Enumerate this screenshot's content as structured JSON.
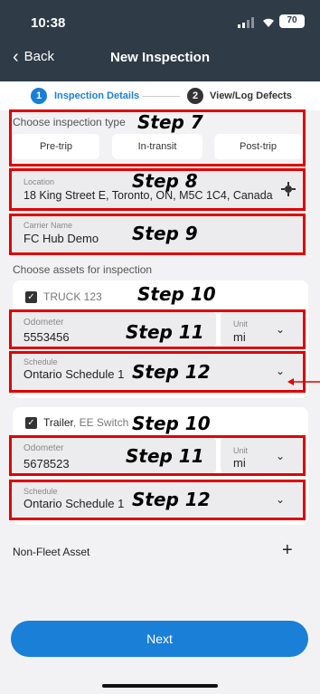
{
  "status": {
    "time": "10:38",
    "battery": "70"
  },
  "nav": {
    "back_label": "Back",
    "title": "New Inspection"
  },
  "stepper": {
    "step1_num": "1",
    "step1_label": "Inspection Details",
    "step2_num": "2",
    "step2_label": "View/Log Defects"
  },
  "inspection_type": {
    "label": "Choose inspection type",
    "options": [
      "Pre-trip",
      "In-transit",
      "Post-trip"
    ]
  },
  "location": {
    "label": "Location",
    "value": "18 King Street E, Toronto, ON, M5C 1C4, Canada"
  },
  "carrier": {
    "label": "Carrier Name",
    "value": "FC Hub Demo"
  },
  "assets": {
    "label": "Choose assets for inspection",
    "truck": {
      "name": "TRUCK 123",
      "odometer_label": "Odometer",
      "odometer_value": "5553456",
      "unit_label": "Unit",
      "unit_value": "mi",
      "schedule_label": "Schedule",
      "schedule_value": "Ontario Schedule 1"
    },
    "trailer": {
      "name_bold": "Trailer",
      "name_rest": ", EE Switch",
      "odometer_label": "Odometer",
      "odometer_value": "5678523",
      "unit_label": "Unit",
      "unit_value": "mi",
      "schedule_label": "Schedule",
      "schedule_value": "Ontario Schedule 1"
    }
  },
  "non_fleet": {
    "label": "Non-Fleet Asset",
    "add": "+"
  },
  "next_label": "Next",
  "annotations": {
    "step7": "Step 7",
    "step8": "Step 8",
    "step9": "Step 9",
    "step10a": "Step 10",
    "step11a": "Step 11",
    "step12a": "Step 12",
    "step10b": "Step 10",
    "step11b": "Step 11",
    "step12b": "Step 12"
  },
  "colors": {
    "accent": "#1a7fd6",
    "header": "#2f3b47",
    "annotation": "#e00000"
  }
}
